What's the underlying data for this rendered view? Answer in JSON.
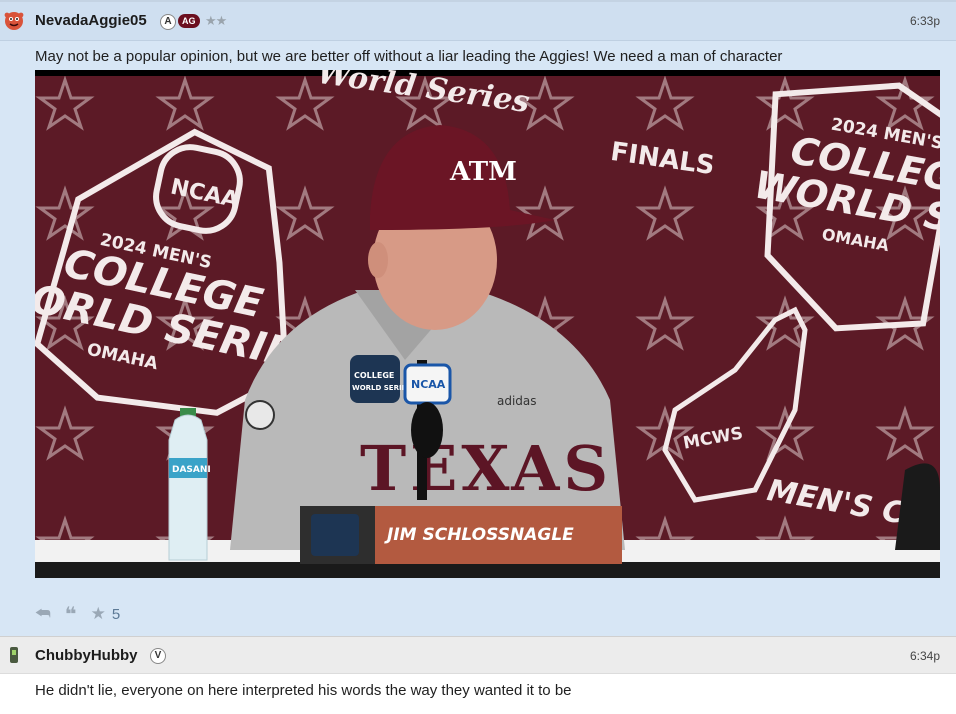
{
  "posts": [
    {
      "username": "NevadaAggie05",
      "badge_letter": "A",
      "badge_team": "AG",
      "rank_stars": "★★",
      "timestamp": "6:33p",
      "body": "May not be a popular opinion, but we are better off without a liar leading the Aggies! We need a man of character",
      "media": {
        "backdrop_top": "World Series",
        "backdrop_finals": "FINALS",
        "logo_year_left": "2024 MEN'S",
        "logo_line1": "COLLEGE",
        "logo_line2_left": "ORLD SERIES",
        "logo_city": "OMAHA",
        "logo_ncaa": "NCAA",
        "logo_year_right": "2024 MEN'S",
        "logo_line2_right": "WORLD SER",
        "finger_text": "MCWS",
        "bottom_right_text": "MEN'S C",
        "cap_logo": "ATM",
        "jersey_text": "TEXAS",
        "jersey_sponsor": "adidas",
        "mic_label": "NCAA",
        "nameplate": "JIM SCHLOSSNAGLE",
        "patch_line1": "COLLEGE",
        "patch_line2": "WORLD SERIES",
        "bottle_label": "DASANI"
      },
      "star_count": "5"
    },
    {
      "username": "ChubbyHubby",
      "badge_letter": "V",
      "timestamp": "6:34p",
      "body": "He didn't lie, everyone on here interpreted his words the way they wanted it to be"
    }
  ],
  "colors": {
    "backdrop_maroon": "#5c1a26",
    "post_bg": "#d7e6f5",
    "team_badge": "#6b0f1f"
  }
}
